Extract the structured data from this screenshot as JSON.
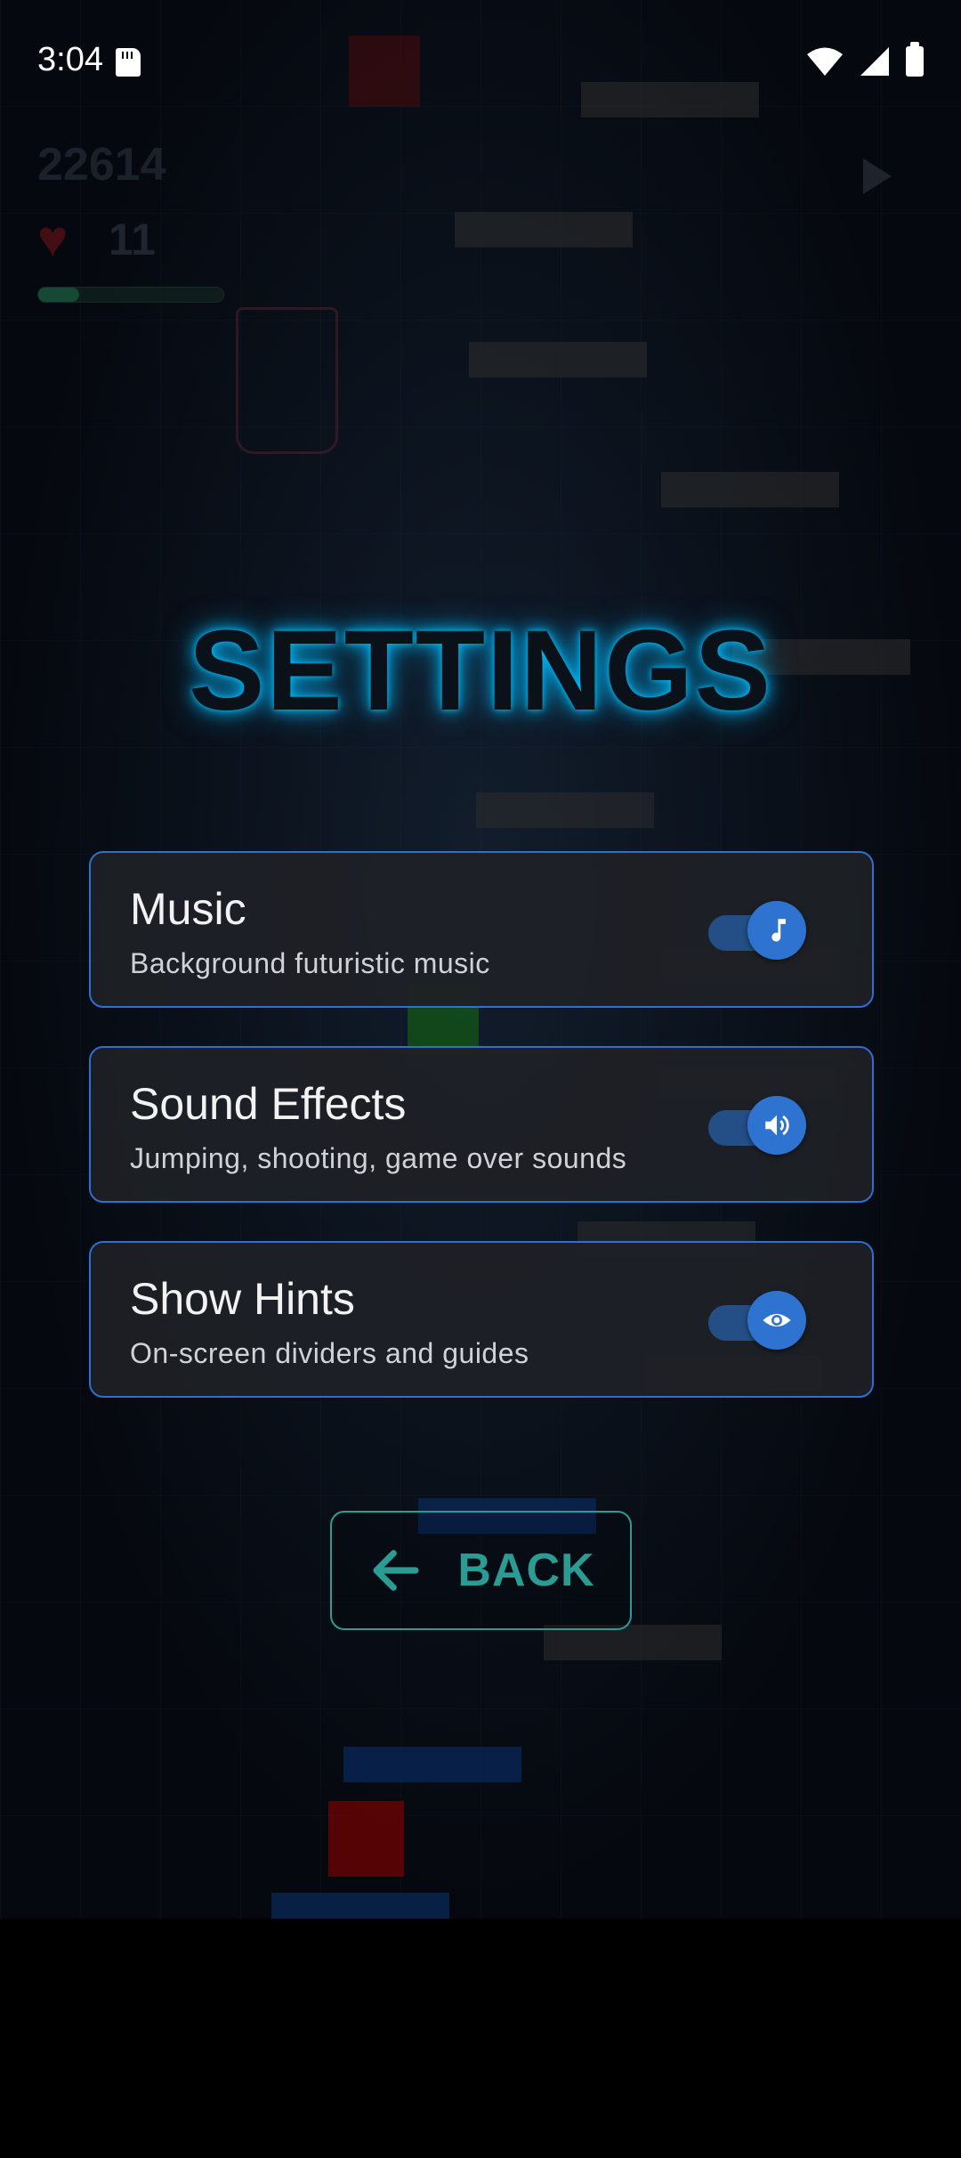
{
  "status_bar": {
    "time": "3:04",
    "icons": [
      "sd-card-icon",
      "wifi-icon",
      "signal-icon",
      "battery-icon"
    ]
  },
  "background": {
    "score": "22614",
    "lives": "11",
    "progress": 0.22
  },
  "title": "SETTINGS",
  "settings": [
    {
      "title": "Music",
      "subtitle": "Background futuristic music",
      "enabled": true,
      "icon": "music-note-icon"
    },
    {
      "title": "Sound Effects",
      "subtitle": "Jumping, shooting, game over sounds",
      "enabled": true,
      "icon": "volume-icon"
    },
    {
      "title": "Show Hints",
      "subtitle": "On-screen dividers and guides",
      "enabled": true,
      "icon": "eye-icon"
    }
  ],
  "back_button": {
    "label": "BACK",
    "icon": "arrow-left-icon"
  },
  "colors": {
    "card_border": "#2f6fd0",
    "toggle_thumb": "#2f73d0",
    "toggle_track": "#234f86",
    "accent_teal": "#2a9c94",
    "title_glow": "#00beff"
  }
}
